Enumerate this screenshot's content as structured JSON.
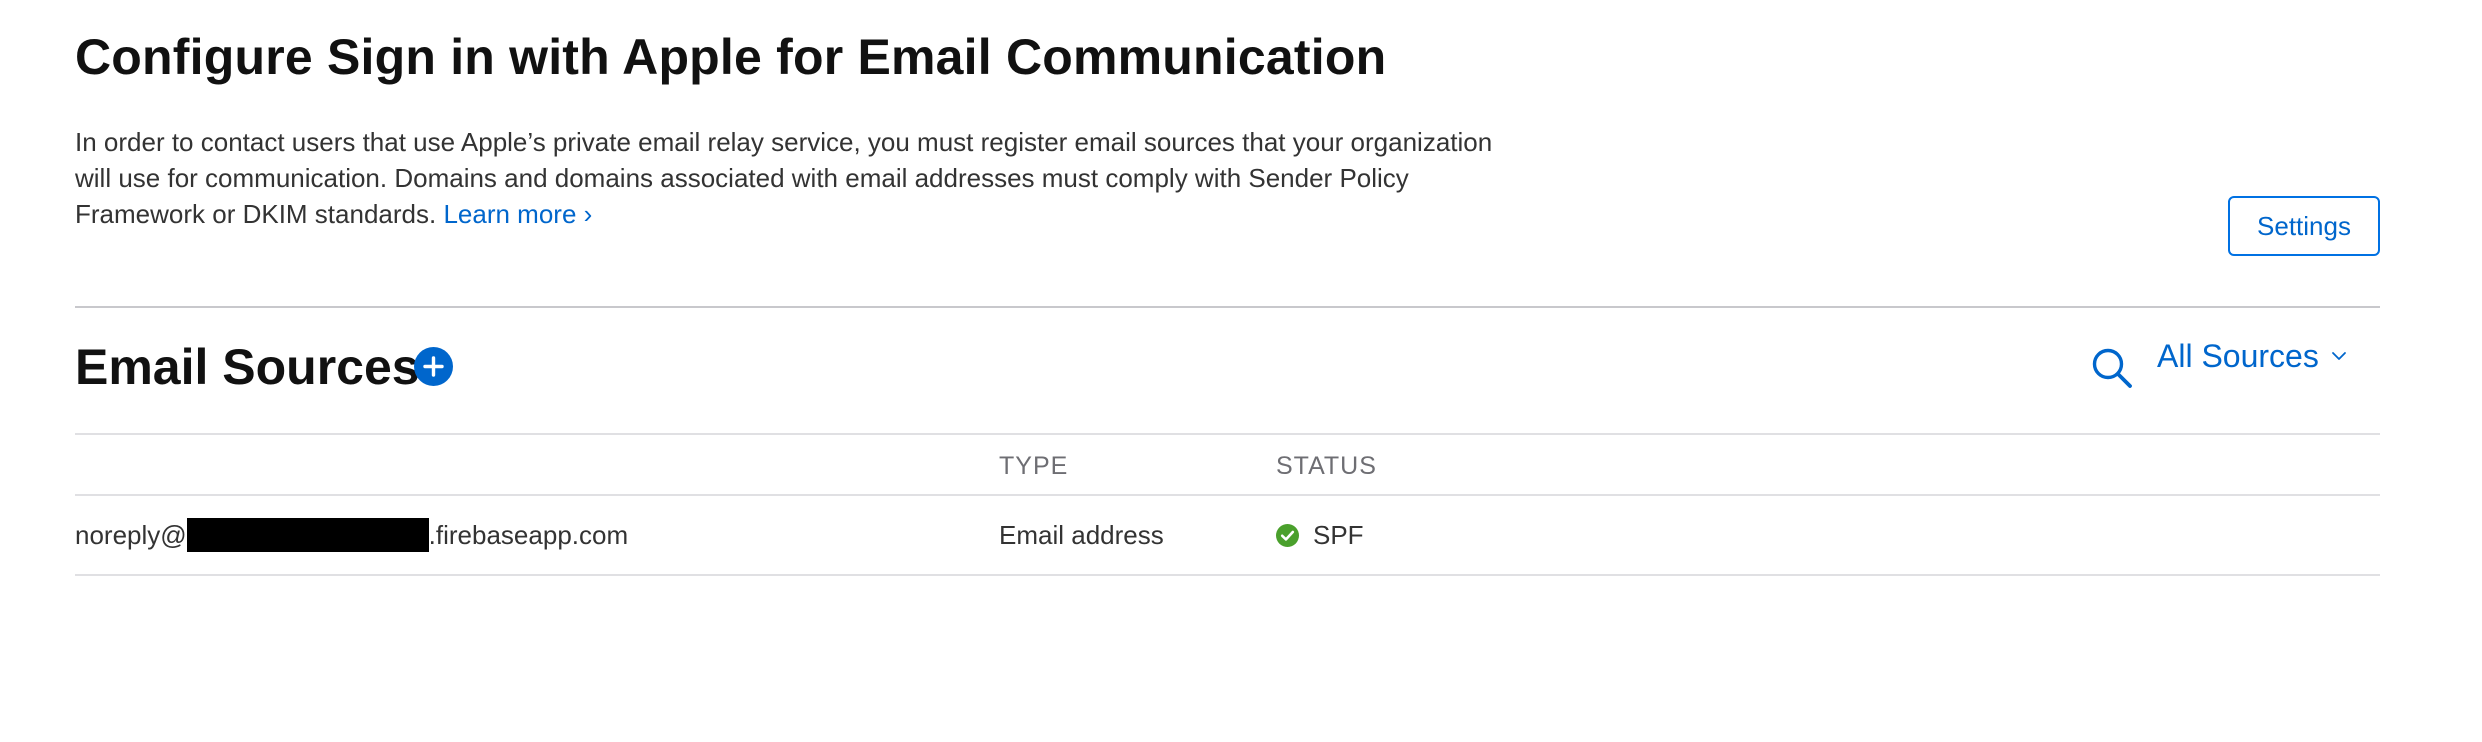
{
  "header": {
    "title": "Configure Sign in with Apple for Email Communication",
    "description": "In order to contact users that use Apple’s private email relay service, you must register email sources that your organization will use for communication. Domains and domains associated with email addresses must comply with Sender Policy Framework or DKIM standards.",
    "learn_more_label": "Learn more ›",
    "settings_label": "Settings"
  },
  "sources": {
    "title": "Email Sources",
    "add_icon": "plus-circle-icon",
    "search_icon": "magnifier-icon",
    "filter_label": "All Sources",
    "filter_icon": "chevron-down-icon",
    "columns": [
      "",
      "TYPE",
      "STATUS"
    ],
    "rows": [
      {
        "source_prefix": "noreply@",
        "source_redacted": true,
        "source_suffix": ".firebaseapp.com",
        "type": "Email address",
        "status": "SPF",
        "status_icon": "check-circle-icon"
      }
    ]
  },
  "colors": {
    "accent": "#0066cc",
    "status_ok": "#4aa02c",
    "divider": "#c8c8cc",
    "heading": "#111111",
    "muted": "#6e6e73"
  }
}
